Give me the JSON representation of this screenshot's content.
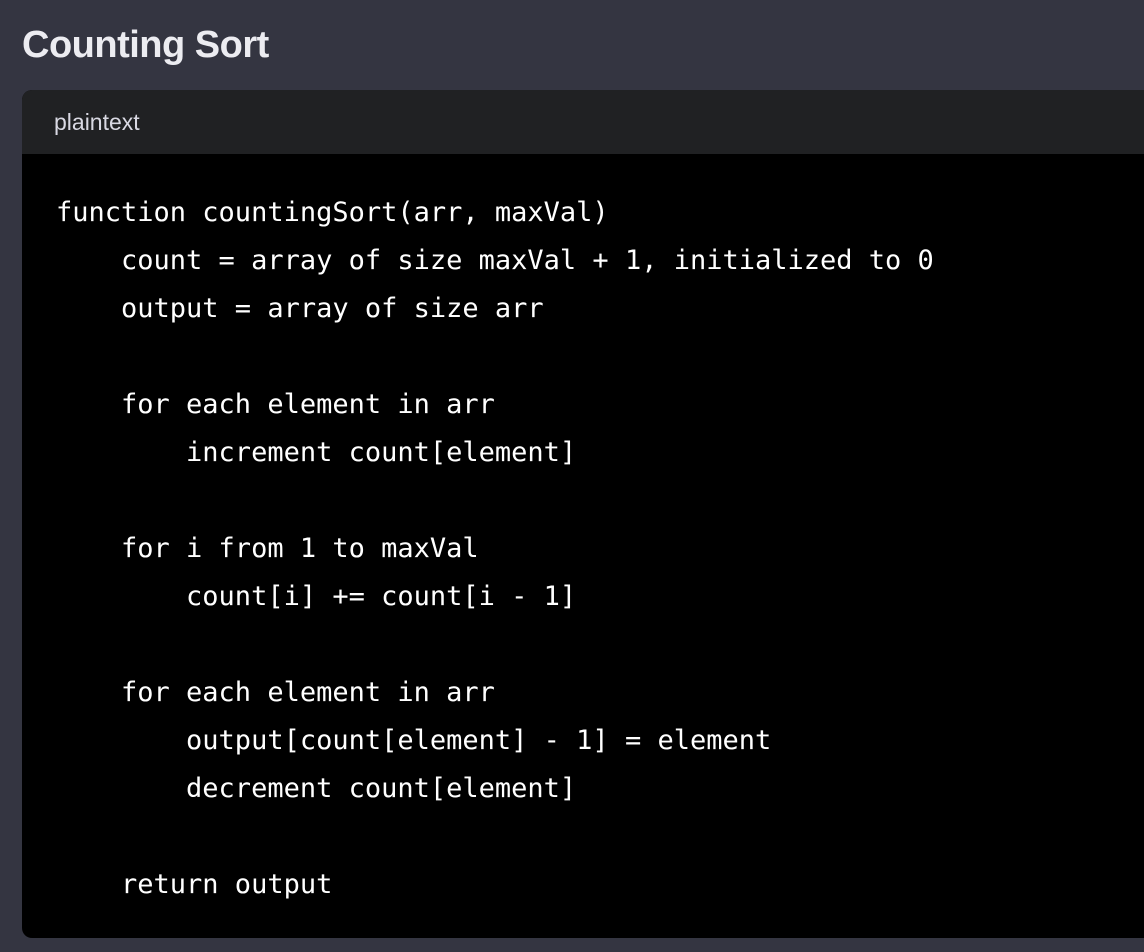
{
  "section": {
    "title": "Counting Sort"
  },
  "code_block": {
    "language": "plaintext",
    "lines": [
      "function countingSort(arr, maxVal)",
      "    count = array of size maxVal + 1, initialized to 0",
      "    output = array of size arr",
      "",
      "    for each element in arr",
      "        increment count[element]",
      "",
      "    for i from 1 to maxVal",
      "        count[i] += count[i - 1]",
      "",
      "    for each element in arr",
      "        output[count[element] - 1] = element",
      "        decrement count[element]",
      "",
      "    return output"
    ]
  },
  "colors": {
    "page_background": "#343541",
    "code_header_background": "#202123",
    "code_background": "#000000",
    "code_text": "#ffffff"
  }
}
